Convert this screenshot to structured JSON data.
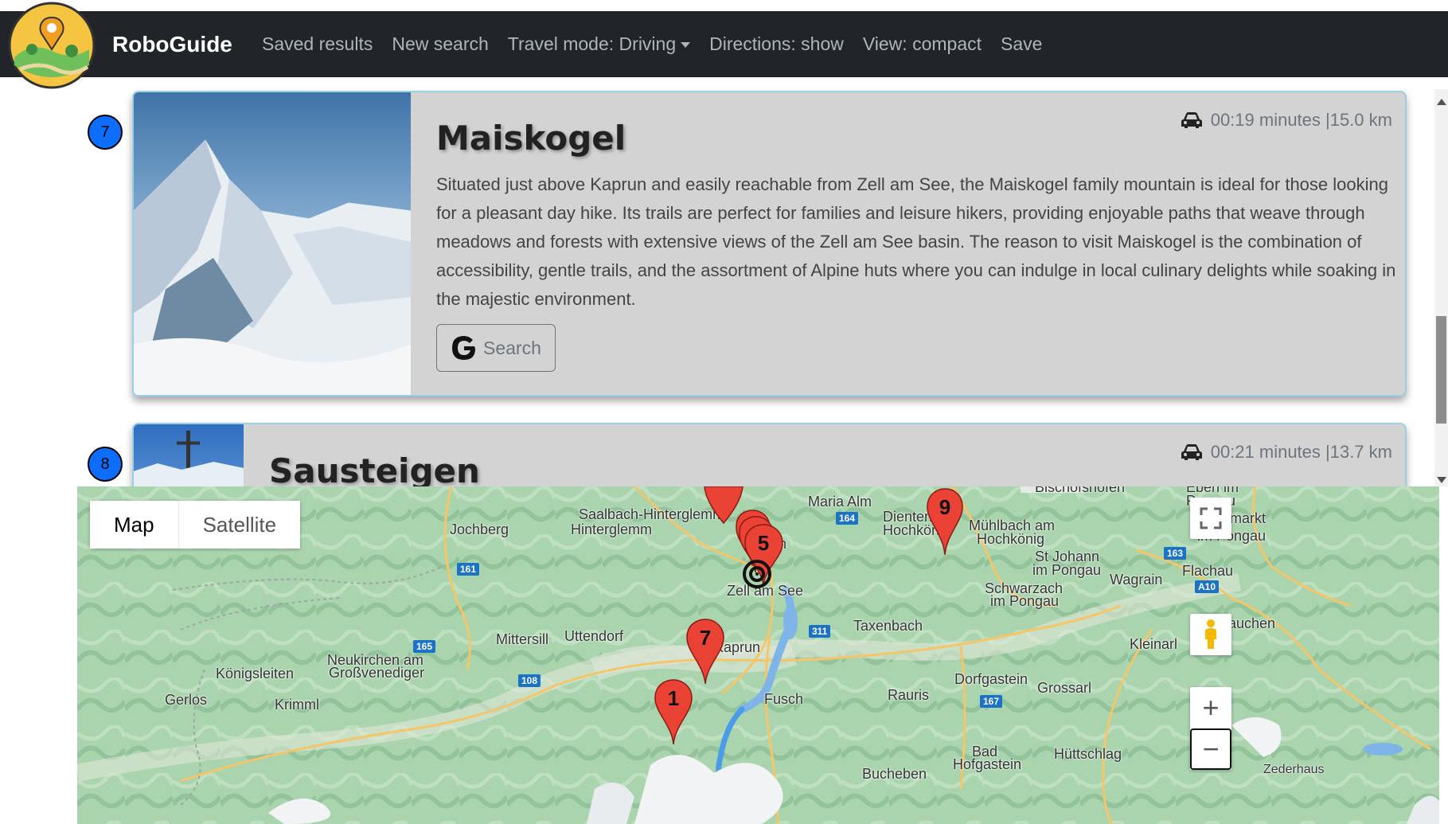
{
  "navbar": {
    "brand": "RoboGuide",
    "logo_icon": "roboguide-logo-icon",
    "links": {
      "saved_results": "Saved results",
      "new_search": "New search",
      "travel_mode": "Travel mode: Driving",
      "directions": "Directions: show",
      "view": "View: compact",
      "save": "Save"
    }
  },
  "results": [
    {
      "number": "7",
      "title": "Maiskogel",
      "travel": "00:19 minutes |15.0 km",
      "description": "Situated just above Kaprun and easily reachable from Zell am See, the Maiskogel family mountain is ideal for those looking for a pleasant day hike. Its trails are perfect for families and leisure hikers, providing enjoyable paths that weave through meadows and forests with extensive views of the Zell am See basin. The reason to visit Maiskogel is the combination of accessibility, gentle trails, and the assortment of Alpine huts where you can indulge in local culinary delights while soaking in the majestic environment.",
      "search_label": "Search"
    },
    {
      "number": "8",
      "title": "Sausteigen",
      "travel": "00:21 minutes |13.7 km"
    }
  ],
  "map": {
    "type_buttons": {
      "map": "Map",
      "satellite": "Satellite"
    },
    "places": {
      "saalbach": "Saalbach-Hinterglemm",
      "hinterglemm": "Hinterglemm",
      "jochberg": "Jochberg",
      "maria_alm": "Maria Alm",
      "dienten": "Dienten am",
      "hochkonig": "Hochkönig",
      "bischofshofen": "Bischofshofen",
      "eben": "Eben im",
      "pongau_top": "Pongau",
      "muhlbach": "Mühlbach am",
      "muhlbach2": "Hochkönig",
      "altenmarkt": "Altenmarkt",
      "altenmarkt2": "im Pongau",
      "st_johann": "St Johann",
      "st_johann2": "im Pongau",
      "wagrain": "Wagrain",
      "flachau": "Flachau",
      "schwarzach": "Schwarzach",
      "schwarzach2": "im Pongau",
      "zell": "Zell am See",
      "taxenbach": "Taxenbach",
      "zauchen": "Zauchen",
      "kleinarl": "Kleinarl",
      "mittersill": "Mittersill",
      "uttendorf": "Uttendorf",
      "kaprun": "Kaprun",
      "neukirchen": "Neukirchen am",
      "neukirchen2": "Großvenediger",
      "konigsleiten": "Königsleiten",
      "gerlos": "Gerlos",
      "krimml": "Krimml",
      "fusch": "Fusch",
      "rauris": "Rauris",
      "dorfgastein": "Dorfgastein",
      "grossarl": "Grossarl",
      "bad_hofgastein": "Bad",
      "bad_hofgastein2": "Hofgastein",
      "huttschlag": "Hüttschlag",
      "bucheben": "Bucheben",
      "zederhaus": "Zederhaus",
      "salzachen": "en"
    },
    "roads": [
      "161",
      "164",
      "163",
      "A10",
      "311",
      "165",
      "108",
      "167"
    ],
    "markers": [
      "9",
      "5",
      "7",
      "1"
    ],
    "controls": {
      "fullscreen_icon": "fullscreen-icon",
      "pegman_icon": "pegman-icon",
      "zoom_in": "+",
      "zoom_out": "−"
    }
  }
}
